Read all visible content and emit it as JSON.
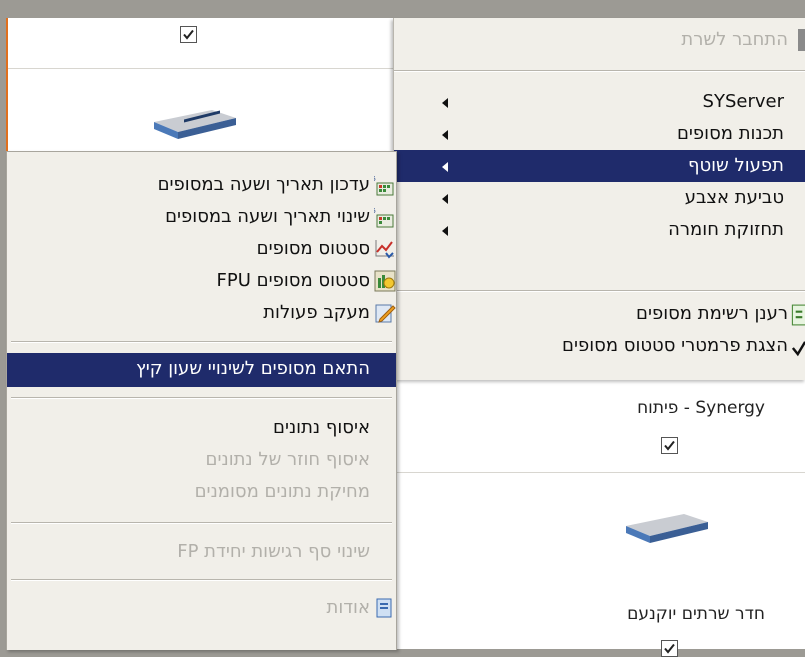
{
  "background_cells": {
    "top_left_checked": true,
    "right_cell_title": "Synergy - פיתוח",
    "right_cell_checked": true,
    "bottom_right_title": "חדר שרתים יוקנעם",
    "bottom_right_checked": true
  },
  "main_menu": {
    "connect_item": "התחבר לשרת",
    "items": [
      {
        "label": "SYServer",
        "has_submenu": true
      },
      {
        "label": "תכנות מסופים",
        "has_submenu": true
      },
      {
        "label": "תפעול שוטף",
        "has_submenu": true,
        "selected": true
      },
      {
        "label": "טביעת אצבע",
        "has_submenu": true
      },
      {
        "label": "תחזוקת חומרה",
        "has_submenu": true
      }
    ],
    "refresh_item": "רענן רשימת מסופים",
    "show_params_item": "הצגת פרמטרי סטטוס מסופים"
  },
  "context_menu": {
    "items": [
      {
        "label": "עדכון תאריך ושעה במסופים",
        "icon": "calendar-icon"
      },
      {
        "label": "שינוי תאריך ושעה במסופים",
        "icon": "calendar-icon"
      },
      {
        "label": "סטטוס מסופים",
        "icon": "status-chart-icon"
      },
      {
        "label": "סטטוס מסופים FPU",
        "icon": "fpu-status-icon"
      },
      {
        "label": "מעקב פעולות",
        "icon": "edit-icon"
      },
      {
        "label": "התאם מסופים לשינויי שעון קיץ",
        "selected": true
      },
      {
        "label": "איסוף נתונים"
      },
      {
        "label": "איסוף חוזר של נתונים",
        "disabled": true
      },
      {
        "label": "מחיקת נתונים מסומנים",
        "disabled": true
      },
      {
        "label": "שינוי סף רגישות יחידת FP",
        "disabled": true
      },
      {
        "label": "אודות",
        "icon": "about-icon",
        "disabled": true
      }
    ]
  },
  "colors": {
    "selection": "#1f2b6b",
    "menu_bg": "#f1efe9",
    "disabled_text": "#b2b0aa",
    "accent_border": "#e0701e"
  }
}
